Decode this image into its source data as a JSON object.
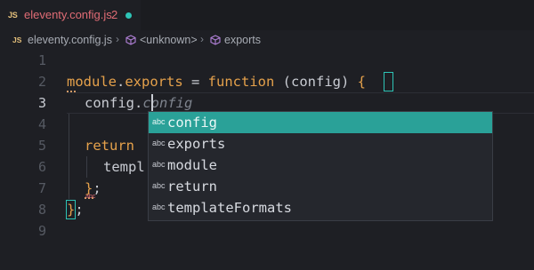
{
  "tab": {
    "language_badge": "JS",
    "file_name": "eleventy.config.js",
    "problem_count": "2"
  },
  "breadcrumb": {
    "language_badge": "JS",
    "file": "eleventy.config.js",
    "symbol_1": "<unknown>",
    "symbol_2": "exports",
    "separator": "›"
  },
  "editor": {
    "line_numbers": [
      "1",
      "2",
      "3",
      "4",
      "5",
      "6",
      "7",
      "8",
      "9"
    ],
    "active_line": "3",
    "lines": {
      "l2": {
        "t1": "module",
        "t2": ".",
        "t3": "exports",
        "t4": " = ",
        "t5": "function",
        "t6": " (config) ",
        "t7": "{"
      },
      "l3": {
        "t1": "config.",
        "ghost": "config"
      },
      "l5": {
        "t1": "return"
      },
      "l6": {
        "t1": "templ"
      },
      "l7": {
        "t1": "}",
        "t2": ";"
      },
      "l8": {
        "t1": "}",
        "t2": ";"
      }
    },
    "abc_marker": "abc"
  },
  "suggest": {
    "items": [
      {
        "kind": "abc",
        "label": "config"
      },
      {
        "kind": "abc",
        "label": "exports"
      },
      {
        "kind": "abc",
        "label": "module"
      },
      {
        "kind": "abc",
        "label": "return"
      },
      {
        "kind": "abc",
        "label": "templateFormats"
      }
    ],
    "selected_index": 0
  },
  "colors": {
    "accent": "#2ec4b6",
    "selection": "#2aa198",
    "keyword": "#e5a14b",
    "error": "#e06c75",
    "background": "#1e1f24"
  }
}
